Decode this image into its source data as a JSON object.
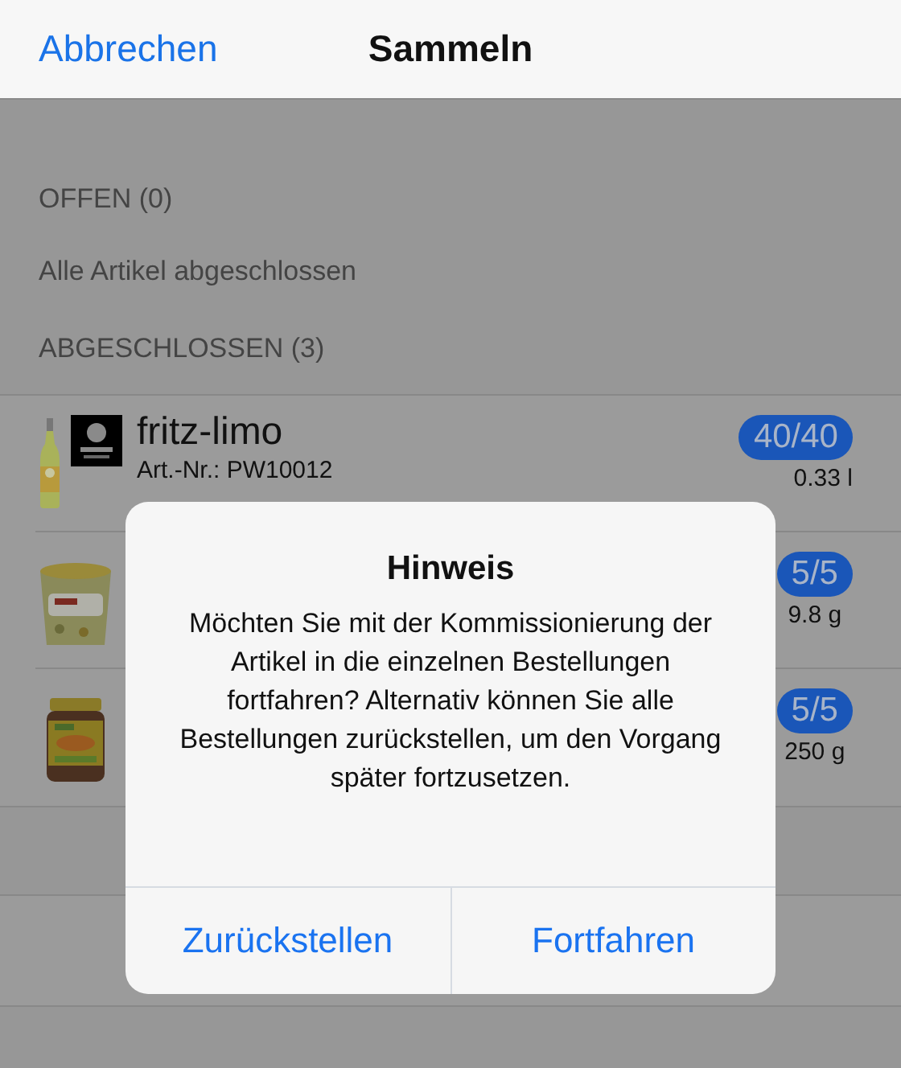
{
  "nav": {
    "cancel": "Abbrechen",
    "title": "Sammeln"
  },
  "sections": [
    {
      "header": "OFFEN (0)",
      "note": "Alle Artikel abgeschlossen"
    },
    {
      "header": "ABGESCHLOSSEN (3)",
      "items": [
        {
          "kind": "picture",
          "name": "fritz-limo",
          "art_nr": "Art.-Nr.: PW10012",
          "count": "40/40",
          "quantity": "0.33 l"
        },
        {
          "kind": "picture",
          "count": "5/5",
          "quantity": "9.8 g"
        },
        {
          "kind": "picture",
          "count": "5/5",
          "quantity": "250 g"
        }
      ]
    }
  ],
  "dialog": {
    "title": "Hinweis",
    "message": "Möchten Sie mit der Kommissionierung der Artikel in die einzelnen Bestellungen fortfahren? Alternativ können Sie alle Bestellungen zurückstellen, um den Vorgang später fortzusetzen.",
    "buttons": [
      "Zurückstellen",
      "Fortfahren"
    ]
  }
}
